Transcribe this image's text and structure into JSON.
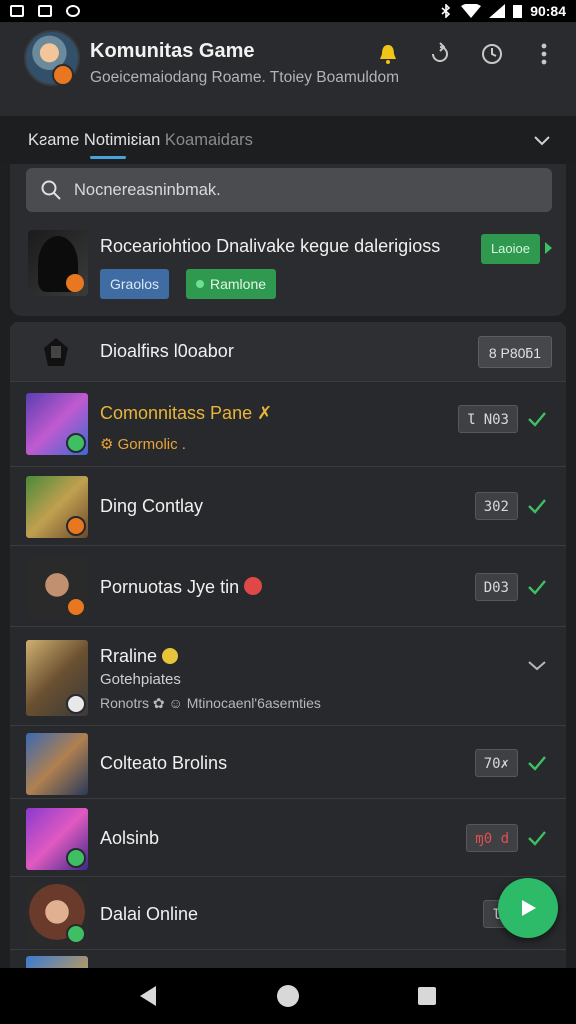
{
  "status_bar": {
    "time": "90:84"
  },
  "header": {
    "title": "Komunitas Game",
    "subtitle": "Goeicemaiodang Roame.  Ttoiey Boamuldom"
  },
  "tab": {
    "label_main": "Kƨame Notimiɛian",
    "label_dim": " Koamaidars"
  },
  "search": {
    "placeholder": "Nocnereasninbmak."
  },
  "promo": {
    "title": "Roceariohtioo Dnalivake kegue dalerigioss",
    "button": "Laoioe",
    "chips": [
      "Graolos",
      "Ramlone"
    ]
  },
  "list_header": {
    "title": "Dioalfiʀs Ɩ0oabor",
    "value": "8 P80ƃ1"
  },
  "rows": [
    {
      "title": "Comonnitass Pane ✗",
      "sub": "⚙ Gormolic .",
      "value": "Ɩ N03",
      "style": "gold"
    },
    {
      "title": "Ding Contlay",
      "value": "302"
    },
    {
      "title": "Pornuotas Jye tin",
      "value": "D03"
    },
    {
      "title": "Rraline",
      "sub": "Gotehpiates",
      "sub2": "Ronotrs ✿ ☺  Mtinocaenl'6asemties",
      "value": ""
    },
    {
      "title": "Colteato Brolins",
      "value": "70✗"
    },
    {
      "title": "Aolsinb",
      "value": "ɱ0 d"
    },
    {
      "title": "Dalai Online",
      "value": "Ɩ’"
    }
  ],
  "colors": {
    "accent": "#4aa3d8",
    "green": "#2dbb6a",
    "gold": "#e8b53a"
  },
  "icons": [
    "bell-icon",
    "recycle-icon",
    "clock-icon",
    "more-vert-icon",
    "search-icon",
    "chevron-down-icon",
    "check-icon",
    "play-icon"
  ]
}
